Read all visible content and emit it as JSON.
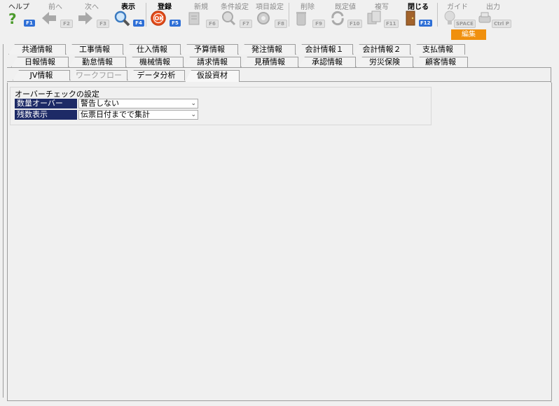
{
  "toolbar": {
    "help": {
      "label": "ヘルプ",
      "key": "F1"
    },
    "prev": {
      "label": "前へ",
      "key": "F2"
    },
    "next": {
      "label": "次へ",
      "key": "F3"
    },
    "show": {
      "label": "表示",
      "key": "F4"
    },
    "save": {
      "label": "登録",
      "key": "F5"
    },
    "new": {
      "label": "新規",
      "key": "F6"
    },
    "cond": {
      "label": "条件設定",
      "key": "F7"
    },
    "item": {
      "label": "項目設定",
      "key": "F8"
    },
    "delete": {
      "label": "削除",
      "key": "F9"
    },
    "default": {
      "label": "既定値",
      "key": "F10"
    },
    "copy": {
      "label": "複写",
      "key": "F11"
    },
    "close": {
      "label": "閉じる",
      "key": "F12"
    },
    "guide": {
      "label": "ガイド",
      "key": "SPACE"
    },
    "output": {
      "label": "出力",
      "key": "Ctrl P"
    },
    "edit_badge": "編集"
  },
  "tabs": {
    "row1": [
      "共通情報",
      "工事情報",
      "仕入情報",
      "予算情報",
      "発注情報",
      "会計情報１",
      "会計情報２",
      "支払情報"
    ],
    "row2": [
      "日報情報",
      "勤怠情報",
      "機械情報",
      "請求情報",
      "見積情報",
      "承認情報",
      "労災保険",
      "顧客情報"
    ],
    "row3": [
      "JV情報",
      "ワークフロー",
      "データ分析",
      "仮設資材"
    ],
    "selected": "仮設資材"
  },
  "settings": {
    "title": "オーバーチェックの設定",
    "rows": [
      {
        "label": "数量オーバー",
        "value": "警告しない"
      },
      {
        "label": "残数表示",
        "value": "伝票日付までで集計"
      }
    ]
  },
  "colors": {
    "accent": "#2e6fd6",
    "field_label_bg": "#1d2a66",
    "edit_badge": "#f0900e"
  }
}
